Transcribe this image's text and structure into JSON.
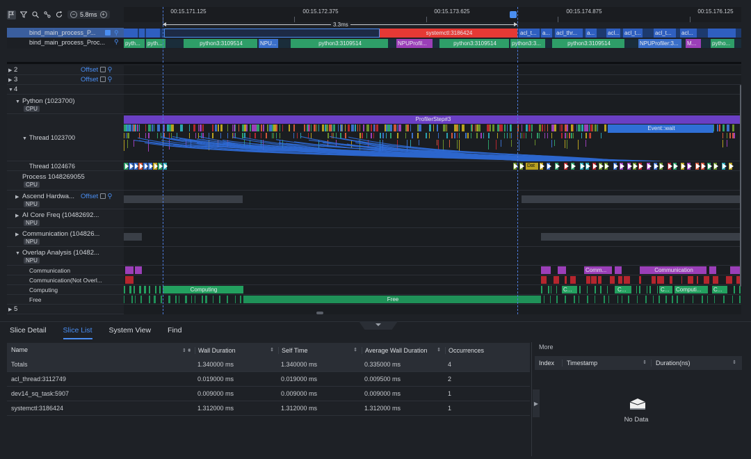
{
  "toolbar": {
    "icons": [
      "flag-icon",
      "filter-icon",
      "search-icon",
      "link-icon",
      "reset-icon"
    ],
    "zoom_label": "5.8ms",
    "zoom_out": "−",
    "zoom_in": "+"
  },
  "ruler": {
    "ticks": [
      "00:15.171.125",
      "00:15.172.375",
      "00:15.173.625",
      "00:15.174.875",
      "00:15.176.125"
    ],
    "selection_label": "3.3ms"
  },
  "pinned": {
    "rows": [
      {
        "label": "bind_main_process_P..."
      },
      {
        "label": "bind_main_process_Proc..."
      }
    ],
    "lane1_slices": [
      {
        "label": ""
      },
      {
        "label": "systemctl:3186424"
      },
      {
        "label": "acl_t..."
      },
      {
        "label": "a..."
      },
      {
        "label": "acl_thr..."
      },
      {
        "label": "a..."
      },
      {
        "label": "acl..."
      },
      {
        "label": "acl_t..."
      },
      {
        "label": "acl_t..."
      },
      {
        "label": "acl..."
      }
    ],
    "lane2_slices": [
      {
        "label": "pyth..."
      },
      {
        "label": "pyth..."
      },
      {
        "label": "python3:3109514"
      },
      {
        "label": "NPU..."
      },
      {
        "label": "python3:3109514"
      },
      {
        "label": "NPUProfil..."
      },
      {
        "label": "python3:3109514"
      },
      {
        "label": "python3:3..."
      },
      {
        "label": "python3:3109514"
      },
      {
        "label": "NPUProfiler:3..."
      },
      {
        "label": "M..."
      },
      {
        "label": "pytho..."
      }
    ]
  },
  "tree": {
    "groups": [
      {
        "label": "2",
        "offset": "Offset"
      },
      {
        "label": "3",
        "offset": "Offset"
      },
      {
        "label": "4"
      }
    ],
    "python_process": {
      "label": "Python (1023700)",
      "tag": "CPU"
    },
    "thread1": "Thread 1023700",
    "thread2": "Thread 1024676",
    "process2": {
      "label": "Process 1048269055",
      "tag": "CPU"
    },
    "ascend": {
      "label": "Ascend Hardwa...",
      "offset": "Offset",
      "tag": "NPU"
    },
    "aicore": {
      "label": "AI Core Freq (10482692...",
      "tag": "NPU"
    },
    "comm": {
      "label": "Communication (104826...",
      "tag": "NPU"
    },
    "overlap": {
      "label": "Overlap Analysis (10482...",
      "tag": "NPU"
    },
    "ov_rows": [
      "Communication",
      "Communication(Not Overl...",
      "Computing",
      "Free"
    ],
    "group5": "5"
  },
  "canvas": {
    "profiler_step": "ProfilerStep#3",
    "event_wait": "Event::wait",
    "ov_comm_labels": [
      "Comm...",
      "Communication"
    ],
    "ov_computing_labels": [
      "Computing",
      "C...",
      "C...",
      "C...",
      "Computi...",
      "C..."
    ],
    "ov_free_label": "Free",
    "thread2_slice": "Dat"
  },
  "bottom": {
    "tabs": [
      "Slice Detail",
      "Slice List",
      "System View",
      "Find"
    ],
    "active_tab": "Slice List",
    "columns": [
      "Name",
      "Wall Duration",
      "Self Time",
      "Average Wall Duration",
      "Occurrences"
    ],
    "rows": [
      {
        "name": "Totals",
        "wall": "1.340000 ms",
        "self": "1.340000 ms",
        "avg": "0.335000 ms",
        "occ": "4"
      },
      {
        "name": "acl_thread:3112749",
        "wall": "0.019000 ms",
        "self": "0.019000 ms",
        "avg": "0.009500 ms",
        "occ": "2"
      },
      {
        "name": "dev14_sq_task:5907",
        "wall": "0.009000 ms",
        "self": "0.009000 ms",
        "avg": "0.009000 ms",
        "occ": "1"
      },
      {
        "name": "systemctl:3186424",
        "wall": "1.312000 ms",
        "self": "1.312000 ms",
        "avg": "1.312000 ms",
        "occ": "1"
      }
    ],
    "more": {
      "title": "More",
      "columns": [
        "Index",
        "Timestamp",
        "Duration(ns)"
      ],
      "empty": "No Data"
    }
  },
  "colors": {
    "accent": "#4a8ef2",
    "selected_slice": "#e53935",
    "python_slice": "#2e9e68",
    "profiler_step": "#6a3fc4",
    "event_wait": "#2f6fd6",
    "communication": "#9b3fb8",
    "comm_not_overlap": "#b5262e",
    "computing": "#23a05f",
    "free": "#1f9158"
  }
}
